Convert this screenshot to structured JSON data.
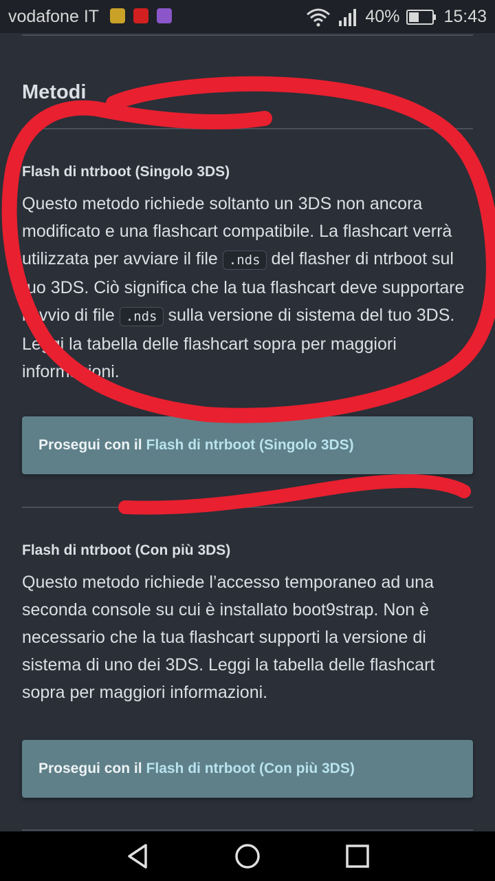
{
  "status_bar": {
    "carrier": "vodafone IT",
    "battery": "40%",
    "time": "15:43"
  },
  "section": {
    "title": "Metodi"
  },
  "methods": [
    {
      "title": "Flash di ntrboot (Singolo 3DS)",
      "desc_part1": "Questo metodo richiede soltanto un 3DS non ancora modificato e una flashcart compatibile. La flashcart verrà utilizzata per avviare il file ",
      "code1": ".nds",
      "desc_part2": " del flasher di ntrboot sul tuo 3DS. Ciò significa che la tua flashcart deve supportare l’avvio di file ",
      "code2": ".nds",
      "desc_part3": " sulla versione di sistema del tuo 3DS. Leggi la tabella delle flashcart sopra per maggiori informazioni.",
      "cta_prefix": "Prosegui con il",
      "cta_link": "Flash di ntrboot (Singolo 3DS)"
    },
    {
      "title": "Flash di ntrboot (Con più 3DS)",
      "desc": "Questo metodo richiede l’accesso temporaneo ad una seconda console su cui è installato boot9strap. Non è necessario che la tua flashcart supporti la versione di sistema di uno dei 3DS. Leggi la tabella delle flashcart sopra per maggiori informazioni.",
      "cta_prefix": "Prosegui con il",
      "cta_link": "Flash di ntrboot (Con più 3DS)"
    }
  ],
  "colors": {
    "page_bg": "#2a2f38",
    "button_bg": "#5f8089",
    "link_text": "#b9e3ee",
    "annotation": "#e8202f"
  },
  "icons": [
    "wifi-icon",
    "signal-icon",
    "battery-icon",
    "back-icon",
    "home-icon",
    "recents-icon"
  ]
}
